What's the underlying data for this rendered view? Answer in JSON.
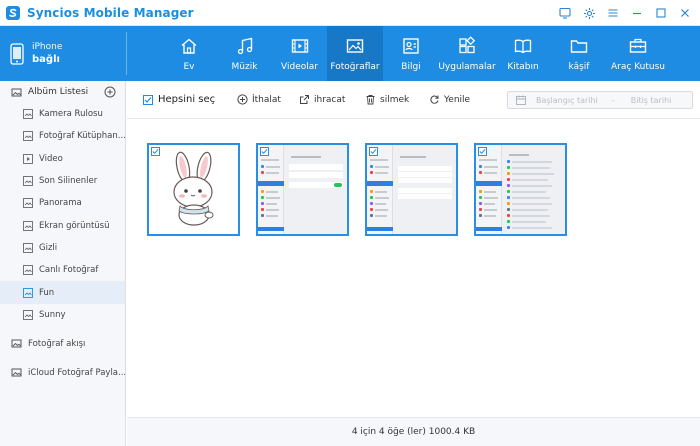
{
  "app": {
    "title": "Syncios Mobile Manager"
  },
  "device": {
    "name": "iPhone",
    "status": "bağlı"
  },
  "nav": [
    {
      "label": "Ev",
      "icon": "home-icon"
    },
    {
      "label": "Müzik",
      "icon": "music-icon"
    },
    {
      "label": "Videolar",
      "icon": "video-icon"
    },
    {
      "label": "Fotoğraflar",
      "icon": "photo-icon",
      "active": true
    },
    {
      "label": "Bilgi",
      "icon": "contact-card-icon"
    },
    {
      "label": "Uygulamalar",
      "icon": "apps-icon"
    },
    {
      "label": "Kitabın",
      "icon": "book-icon"
    },
    {
      "label": "kâşif",
      "icon": "folder-icon"
    },
    {
      "label": "Araç Kutusu",
      "icon": "toolbox-icon"
    }
  ],
  "sidebar": {
    "album_header": "Albüm Listesi",
    "albums": [
      {
        "label": "Kamera Rulosu",
        "icon": "camera-roll-icon"
      },
      {
        "label": "Fotoğraf Kütüphan...",
        "icon": "library-icon"
      },
      {
        "label": "Video",
        "icon": "video-small-icon"
      },
      {
        "label": "Son Silinenler",
        "icon": "album-icon"
      },
      {
        "label": "Panorama",
        "icon": "album-icon"
      },
      {
        "label": "Ekran görüntüsü",
        "icon": "album-icon"
      },
      {
        "label": "Gizli",
        "icon": "album-icon"
      },
      {
        "label": "Canlı Fotoğraf",
        "icon": "album-icon"
      },
      {
        "label": "Fun",
        "icon": "album-icon",
        "active": true
      },
      {
        "label": "Sunny",
        "icon": "album-icon"
      }
    ],
    "groups": [
      {
        "label": "Fotoğraf akışı",
        "icon": "photo-stream-icon"
      },
      {
        "label": "iCloud Fotoğraf Payla...",
        "icon": "icloud-share-icon"
      }
    ]
  },
  "toolbar": {
    "select_all": "Hepsini seç",
    "import": "İthalat",
    "export": "ihracat",
    "delete": "silmek",
    "refresh": "Yenile",
    "date_start": "Başlangıç tarihi",
    "date_separator": "-",
    "date_end": "Bitiş tarihi"
  },
  "photos": [
    {
      "kind": "bunny",
      "selected": true
    },
    {
      "kind": "settings-screenshot",
      "selected": true
    },
    {
      "kind": "settings-screenshot",
      "selected": true
    },
    {
      "kind": "settings-screenshot",
      "selected": true
    }
  ],
  "status": {
    "text": "4 için 4 öğe (ler) 1000.4 KB"
  },
  "colors": {
    "accent": "#1d8ce2",
    "nav_active": "#1678c6",
    "sidebar_active": "#e5eef8"
  }
}
